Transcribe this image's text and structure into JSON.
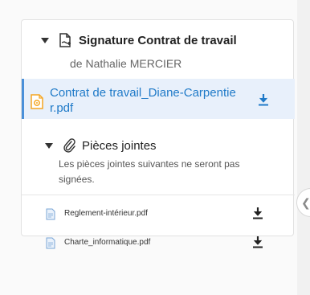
{
  "envelope": {
    "title": "Signature Contrat de travail",
    "sender": "de Nathalie MERCIER",
    "main_document": {
      "name": "Contrat de travail_Diane-Carpentier.pdf",
      "icon": "pdf-file-icon",
      "download_icon": "download-icon"
    }
  },
  "attachments": {
    "title": "Pièces jointes",
    "note": "Les pièces jointes suivantes ne seront pas signées.",
    "files": [
      {
        "name": "Reglement-intérieur.pdf"
      },
      {
        "name": "Charte_informatique.pdf"
      }
    ]
  },
  "colors": {
    "accent": "#1f7ac8",
    "selected_bg": "#e8f0fb",
    "pdf_orange": "#f5a623"
  }
}
